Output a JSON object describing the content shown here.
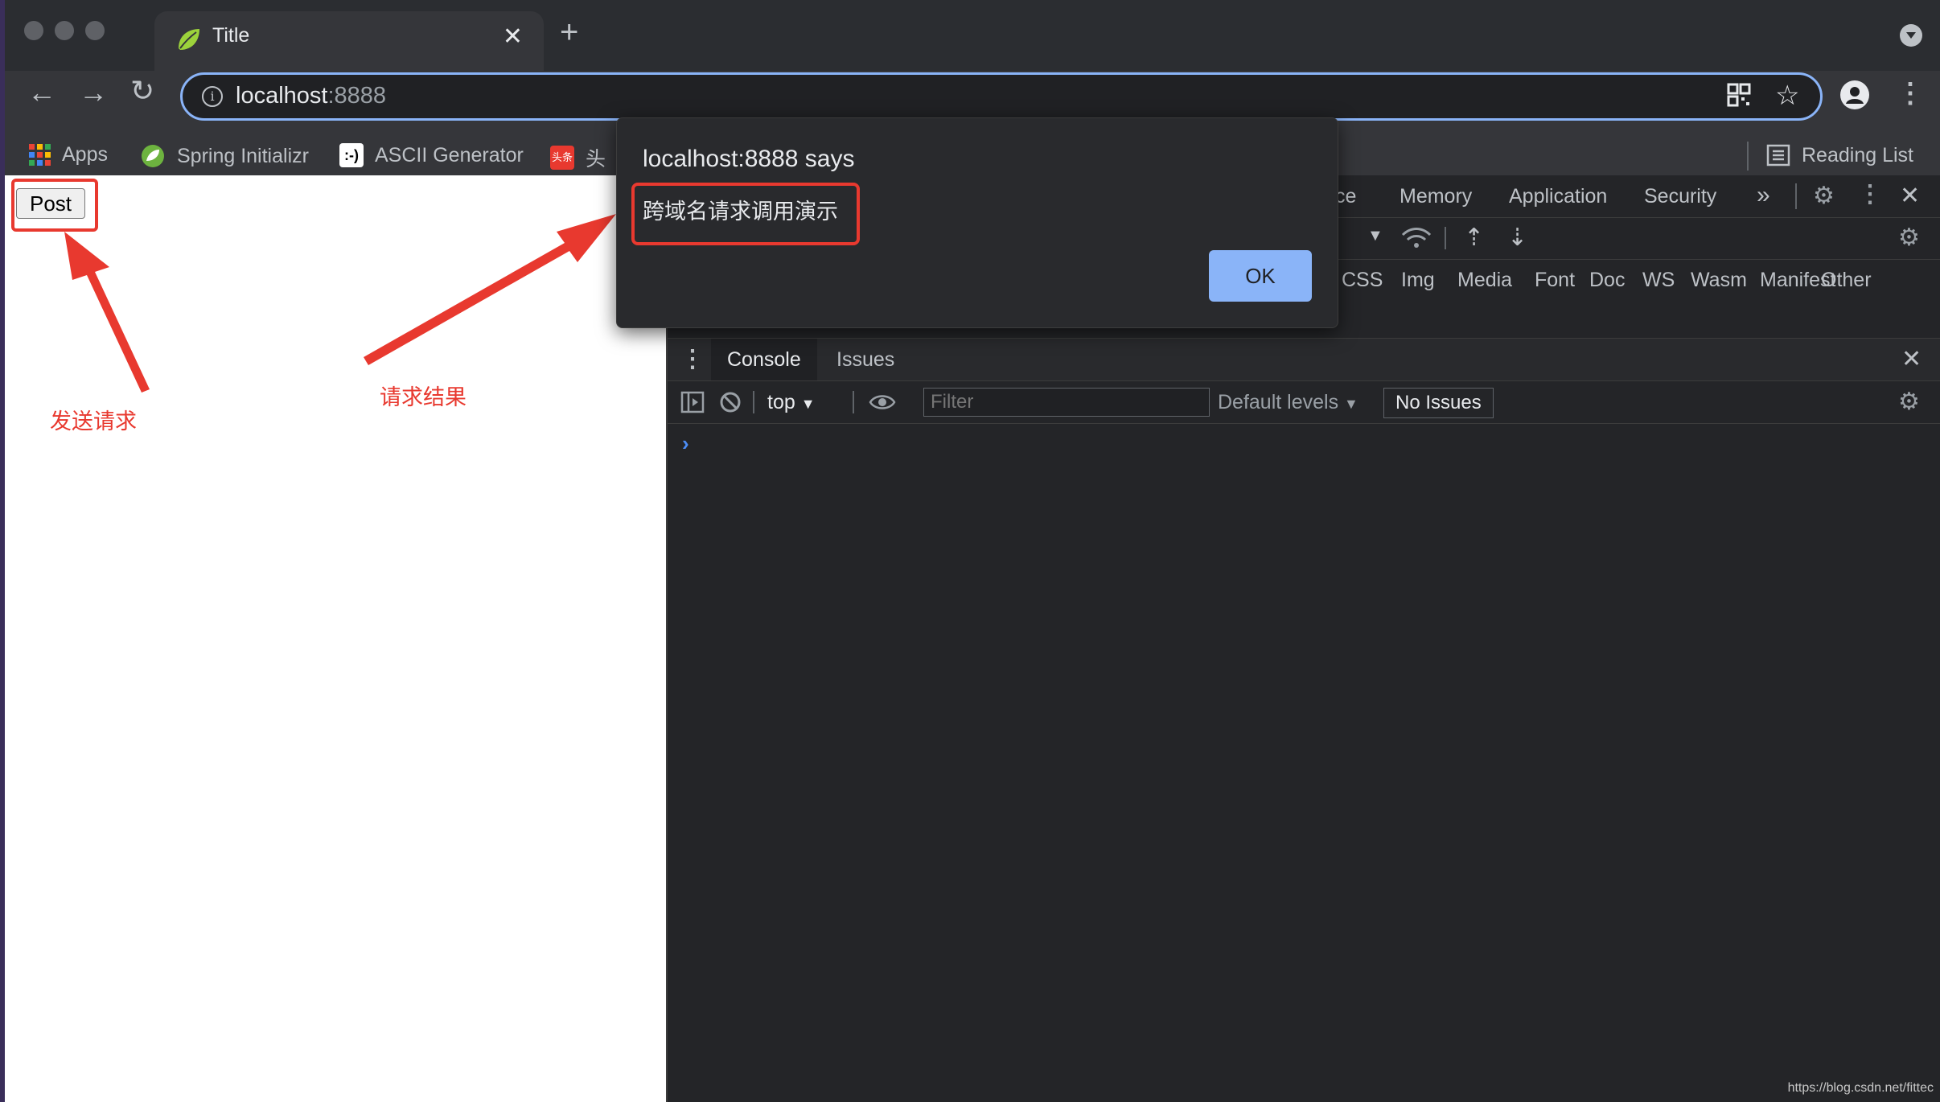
{
  "tab": {
    "title": "Title"
  },
  "omnibox": {
    "host": "localhost",
    "port": ":8888"
  },
  "bookmarks": [
    {
      "label": "Apps",
      "icon": "apps-grid-icon"
    },
    {
      "label": "Spring Initializr",
      "icon": "spring-leaf-icon"
    },
    {
      "label": "ASCII Generator",
      "icon": "ascii-face-icon"
    },
    {
      "label": "头",
      "icon": "toutiao-icon"
    }
  ],
  "reading_list": "Reading List",
  "page": {
    "post_button": "Post",
    "annotation_send": "发送请求",
    "annotation_result": "请求结果"
  },
  "devtools": {
    "tabs": [
      "ce",
      "Memory",
      "Application",
      "Security"
    ],
    "more": "»",
    "filter_types": [
      "CSS",
      "Img",
      "Media",
      "Font",
      "Doc",
      "WS",
      "Wasm",
      "Manifest",
      "Other"
    ],
    "drawer_tabs": [
      "Console",
      "Issues"
    ],
    "console": {
      "context": "top",
      "filter_placeholder": "Filter",
      "levels": "Default levels",
      "issues": "No Issues",
      "prompt": "›"
    }
  },
  "dialog": {
    "title": "localhost:8888 says",
    "message": "跨域名请求调用演示",
    "ok": "OK"
  },
  "watermark": "https://blog.csdn.net/fittec"
}
